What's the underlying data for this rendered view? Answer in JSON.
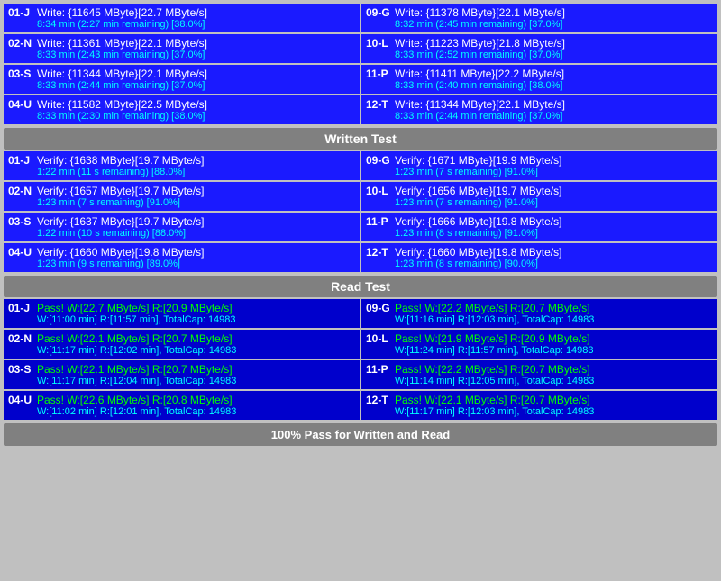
{
  "sections": {
    "write": {
      "header": "Written Test",
      "cells": [
        {
          "label": "01-J",
          "line1": "Write: {11645 MByte}[22.7 MByte/s]",
          "line2": "8:34 min (2:27 min remaining)  [38.0%]"
        },
        {
          "label": "09-G",
          "line1": "Write: {11378 MByte}[22.1 MByte/s]",
          "line2": "8:32 min (2:45 min remaining)  [37.0%]"
        },
        {
          "label": "02-N",
          "line1": "Write: {11361 MByte}[22.1 MByte/s]",
          "line2": "8:33 min (2:43 min remaining)  [37.0%]"
        },
        {
          "label": "10-L",
          "line1": "Write: {11223 MByte}[21.8 MByte/s]",
          "line2": "8:33 min (2:52 min remaining)  [37.0%]"
        },
        {
          "label": "03-S",
          "line1": "Write: {11344 MByte}[22.1 MByte/s]",
          "line2": "8:33 min (2:44 min remaining)  [37.0%]"
        },
        {
          "label": "11-P",
          "line1": "Write: {11411 MByte}[22.2 MByte/s]",
          "line2": "8:33 min (2:40 min remaining)  [38.0%]"
        },
        {
          "label": "04-U",
          "line1": "Write: {11582 MByte}[22.5 MByte/s]",
          "line2": "8:33 min (2:30 min remaining)  [38.0%]"
        },
        {
          "label": "12-T",
          "line1": "Write: {11344 MByte}[22.1 MByte/s]",
          "line2": "8:33 min (2:44 min remaining)  [37.0%]"
        }
      ]
    },
    "verify": {
      "cells": [
        {
          "label": "01-J",
          "line1": "Verify: {1638 MByte}[19.7 MByte/s]",
          "line2": "1:22 min (11 s remaining)   [88.0%]"
        },
        {
          "label": "09-G",
          "line1": "Verify: {1671 MByte}[19.9 MByte/s]",
          "line2": "1:23 min (7 s remaining)   [91.0%]"
        },
        {
          "label": "02-N",
          "line1": "Verify: {1657 MByte}[19.7 MByte/s]",
          "line2": "1:23 min (7 s remaining)   [91.0%]"
        },
        {
          "label": "10-L",
          "line1": "Verify: {1656 MByte}[19.7 MByte/s]",
          "line2": "1:23 min (7 s remaining)   [91.0%]"
        },
        {
          "label": "03-S",
          "line1": "Verify: {1637 MByte}[19.7 MByte/s]",
          "line2": "1:22 min (10 s remaining)   [88.0%]"
        },
        {
          "label": "11-P",
          "line1": "Verify: {1666 MByte}[19.8 MByte/s]",
          "line2": "1:23 min (8 s remaining)   [91.0%]"
        },
        {
          "label": "04-U",
          "line1": "Verify: {1660 MByte}[19.8 MByte/s]",
          "line2": "1:23 min (9 s remaining)   [89.0%]"
        },
        {
          "label": "12-T",
          "line1": "Verify: {1660 MByte}[19.8 MByte/s]",
          "line2": "1:23 min (8 s remaining)   [90.0%]"
        }
      ]
    },
    "read": {
      "header": "Read Test",
      "cells": [
        {
          "label": "01-J",
          "line1": "Pass! W:[22.7 MByte/s] R:[20.9 MByte/s]",
          "line2": "W:[11:00 min] R:[11:57 min], TotalCap: 14983"
        },
        {
          "label": "09-G",
          "line1": "Pass! W:[22.2 MByte/s] R:[20.7 MByte/s]",
          "line2": "W:[11:16 min] R:[12:03 min], TotalCap: 14983"
        },
        {
          "label": "02-N",
          "line1": "Pass! W:[22.1 MByte/s] R:[20.7 MByte/s]",
          "line2": "W:[11:17 min] R:[12:02 min], TotalCap: 14983"
        },
        {
          "label": "10-L",
          "line1": "Pass! W:[21.9 MByte/s] R:[20.9 MByte/s]",
          "line2": "W:[11:24 min] R:[11:57 min], TotalCap: 14983"
        },
        {
          "label": "03-S",
          "line1": "Pass! W:[22.1 MByte/s] R:[20.7 MByte/s]",
          "line2": "W:[11:17 min] R:[12:04 min], TotalCap: 14983"
        },
        {
          "label": "11-P",
          "line1": "Pass! W:[22.2 MByte/s] R:[20.7 MByte/s]",
          "line2": "W:[11:14 min] R:[12:05 min], TotalCap: 14983"
        },
        {
          "label": "04-U",
          "line1": "Pass! W:[22.6 MByte/s] R:[20.8 MByte/s]",
          "line2": "W:[11:02 min] R:[12:01 min], TotalCap: 14983"
        },
        {
          "label": "12-T",
          "line1": "Pass! W:[22.1 MByte/s] R:[20.7 MByte/s]",
          "line2": "W:[11:17 min] R:[12:03 min], TotalCap: 14983"
        }
      ]
    }
  },
  "footer": "100% Pass for Written and Read"
}
